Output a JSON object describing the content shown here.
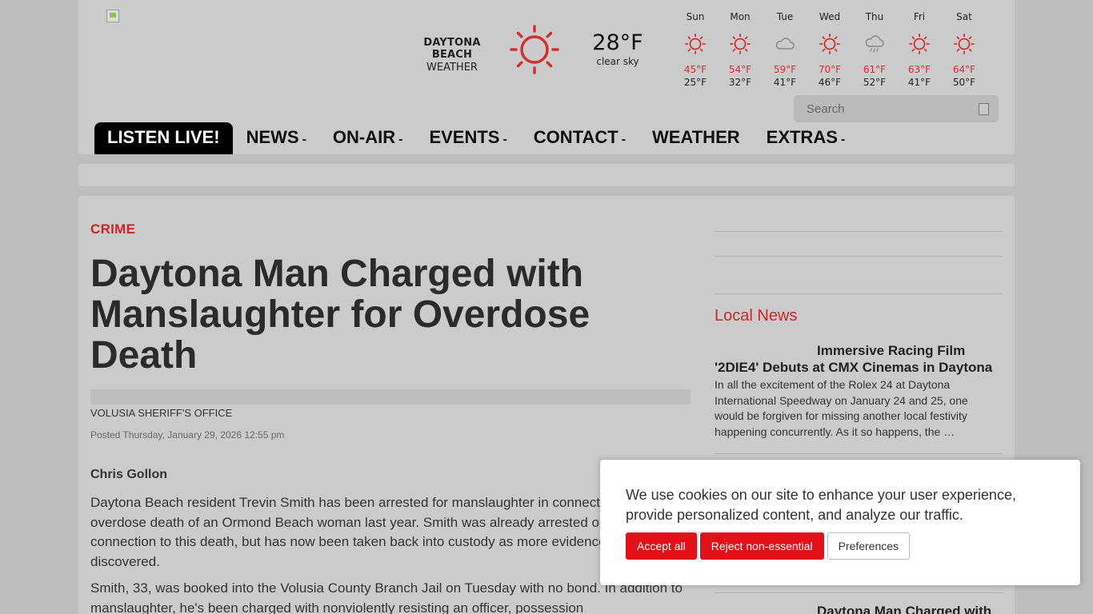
{
  "weather": {
    "city": "DAYTONA BEACH",
    "label": "WEATHER",
    "current_temp": "28°F",
    "current_desc": "clear sky",
    "forecast": [
      {
        "day": "Sun",
        "icon": "sun-icon",
        "hi": "45°F",
        "lo": "25°F"
      },
      {
        "day": "Mon",
        "icon": "sun-icon",
        "hi": "54°F",
        "lo": "32°F"
      },
      {
        "day": "Tue",
        "icon": "cloud-icon",
        "hi": "59°F",
        "lo": "41°F"
      },
      {
        "day": "Wed",
        "icon": "sun-icon",
        "hi": "70°F",
        "lo": "46°F"
      },
      {
        "day": "Thu",
        "icon": "rain-cloud-icon",
        "hi": "61°F",
        "lo": "52°F"
      },
      {
        "day": "Fri",
        "icon": "sun-icon",
        "hi": "63°F",
        "lo": "41°F"
      },
      {
        "day": "Sat",
        "icon": "sun-icon",
        "hi": "64°F",
        "lo": "50°F"
      }
    ]
  },
  "search": {
    "placeholder": "Search"
  },
  "nav": {
    "listen": "LISTEN LIVE!",
    "items": [
      "NEWS",
      "ON-AIR",
      "EVENTS",
      "CONTACT",
      "WEATHER",
      "EXTRAS"
    ],
    "caret": "-"
  },
  "article": {
    "category": "CRIME",
    "headline": "Daytona Man Charged with Manslaughter for Overdose Death",
    "credit": "VOLUSIA SHERIFF'S OFFICE",
    "posted": "Posted Thursday, January 29, 2026 12:55 pm",
    "author": "Chris Gollon",
    "paragraphs": [
      "Daytona Beach resident Trevin Smith has been arrested for manslaughter in connection with the overdose death of an Ormond Beach woman last year. Smith was already arrested once in connection to this death, but has now been taken back into custody as more evidence has been discovered.",
      "Smith, 33, was booked into the Volusia County Branch Jail on Tuesday with no bond. In addition to manslaughter, he's been charged with nonviolently resisting an officer, possession"
    ]
  },
  "sidebar": {
    "local_title": "Local News",
    "story1_title": "Immersive Racing Film '2DIE4' Debuts at CMX Cinemas in Daytona",
    "story1_excerpt": "In all the excitement of the Rolex 24 at Daytona International Speedway on January 24 and 25, one would be forgiven for missing another local festivity happening concurrently. As it so happens, the …",
    "story2_title": "Daytona Man Charged with"
  },
  "cookie": {
    "message": "We use cookies on our site to enhance your user experience, provide personalized content, and analyze our traffic.",
    "accept": "Accept all",
    "reject": "Reject non-essential",
    "prefs": "Preferences"
  },
  "colors": {
    "accent": "#c62828",
    "button_red": "#e3101a",
    "sun": "#d32f2f"
  }
}
